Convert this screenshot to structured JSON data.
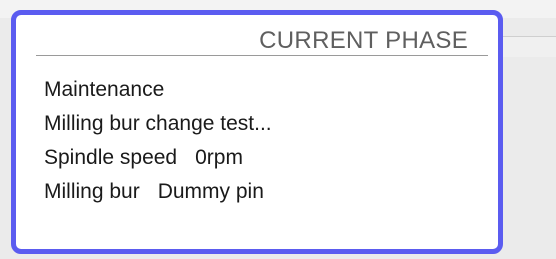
{
  "panel": {
    "title": "CURRENT PHASE",
    "phase": "Maintenance",
    "task": "Milling bur change test...",
    "spindle_speed_label": "Spindle speed",
    "spindle_speed_value": "0rpm",
    "milling_bur_label": "Milling bur",
    "milling_bur_value": "Dummy pin"
  },
  "colors": {
    "panel_border": "#5b5cf0",
    "title_text": "#5f5f5f"
  }
}
